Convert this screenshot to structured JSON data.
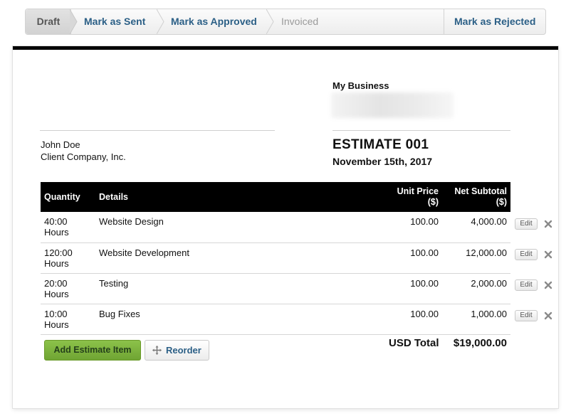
{
  "status_bar": {
    "steps": [
      {
        "label": "Draft",
        "state": "active"
      },
      {
        "label": "Mark as Sent",
        "state": "action"
      },
      {
        "label": "Mark as Approved",
        "state": "action"
      },
      {
        "label": "Invoiced",
        "state": "disabled"
      }
    ],
    "reject_label": "Mark as Rejected"
  },
  "business": {
    "name": "My Business"
  },
  "client": {
    "name": "John Doe",
    "company": "Client Company, Inc."
  },
  "estimate": {
    "title": "ESTIMATE 001",
    "date": "November 15th, 2017"
  },
  "table": {
    "headers": {
      "quantity": "Quantity",
      "details": "Details",
      "unit_price": "Unit Price",
      "unit_price_unit": "($)",
      "net_subtotal": "Net Subtotal",
      "net_subtotal_unit": "($)"
    },
    "rows": [
      {
        "qty": "40:00",
        "unit": "Hours",
        "details": "Website Design",
        "price": "100.00",
        "subtotal": "4,000.00"
      },
      {
        "qty": "120:00",
        "unit": "Hours",
        "details": "Website Development",
        "price": "100.00",
        "subtotal": "12,000.00"
      },
      {
        "qty": "20:00",
        "unit": "Hours",
        "details": "Testing",
        "price": "100.00",
        "subtotal": "2,000.00"
      },
      {
        "qty": "10:00",
        "unit": "Hours",
        "details": "Bug Fixes",
        "price": "100.00",
        "subtotal": "1,000.00"
      }
    ],
    "edit_label": "Edit"
  },
  "footer": {
    "add_label": "Add Estimate Item",
    "reorder_label": "Reorder",
    "total_label": "USD Total",
    "total_value": "$19,000.00"
  },
  "colors": {
    "link_blue": "#2b5f86",
    "add_green": "#7db43f",
    "header_black": "#000000"
  },
  "icons": {
    "delete": "close-x-icon",
    "reorder": "move-arrows-icon",
    "chevron": "chevron-right-icon"
  }
}
